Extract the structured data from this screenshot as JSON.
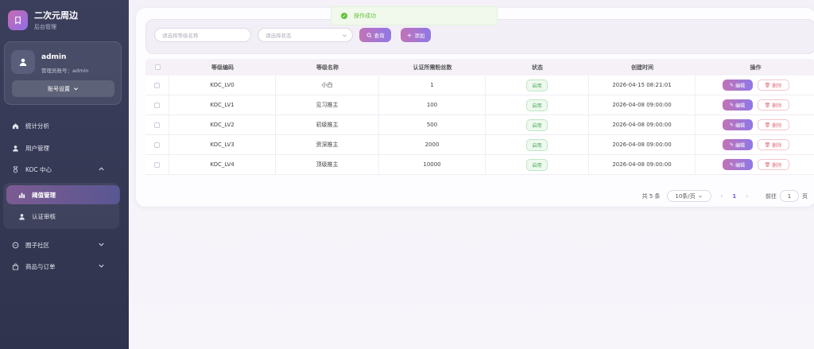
{
  "brand": {
    "title": "二次元周边",
    "subtitle": "后台管理"
  },
  "user": {
    "name": "admin",
    "account": "管理员账号：admin",
    "settings_label": "账号设置"
  },
  "menu": {
    "stats": "统计分析",
    "users": "用户管理",
    "koc": "KOC 中心",
    "koc_sub": [
      "阈值管理",
      "认证审核"
    ],
    "circle": "圈子社区",
    "shop": "商品与订单"
  },
  "toast": {
    "message": "操作成功"
  },
  "filters": {
    "level_placeholder": "请选择等级名称",
    "status_placeholder": "请选择状态",
    "search_label": "查询",
    "add_label": "添加"
  },
  "table": {
    "headers": [
      "等级编码",
      "等级名称",
      "认证所需粉丝数",
      "状态",
      "创建时间",
      "操作"
    ],
    "rows": [
      {
        "code": "KOC_LV0",
        "name": "小白",
        "fans": "1",
        "status": "启用",
        "time": "2026-04-15 08:21:01"
      },
      {
        "code": "KOC_LV1",
        "name": "见习推主",
        "fans": "100",
        "status": "启用",
        "time": "2026-04-08 09:00:00"
      },
      {
        "code": "KOC_LV2",
        "name": "初级推主",
        "fans": "500",
        "status": "启用",
        "time": "2026-04-08 09:00:00"
      },
      {
        "code": "KOC_LV3",
        "name": "资深推主",
        "fans": "2000",
        "status": "启用",
        "time": "2026-04-08 09:00:00"
      },
      {
        "code": "KOC_LV4",
        "name": "顶级推主",
        "fans": "10000",
        "status": "启用",
        "time": "2026-04-08 09:00:00"
      }
    ],
    "edit_label": "编辑",
    "delete_label": "删除"
  },
  "pagination": {
    "total": "共 5 条",
    "page_size": "10条/页",
    "current": "1",
    "goto_prefix": "前往",
    "goto_value": "1",
    "goto_suffix": "页"
  },
  "colors": {
    "accent": "#8f78e6",
    "sidebar": "#343852",
    "success": "#67c23a"
  }
}
